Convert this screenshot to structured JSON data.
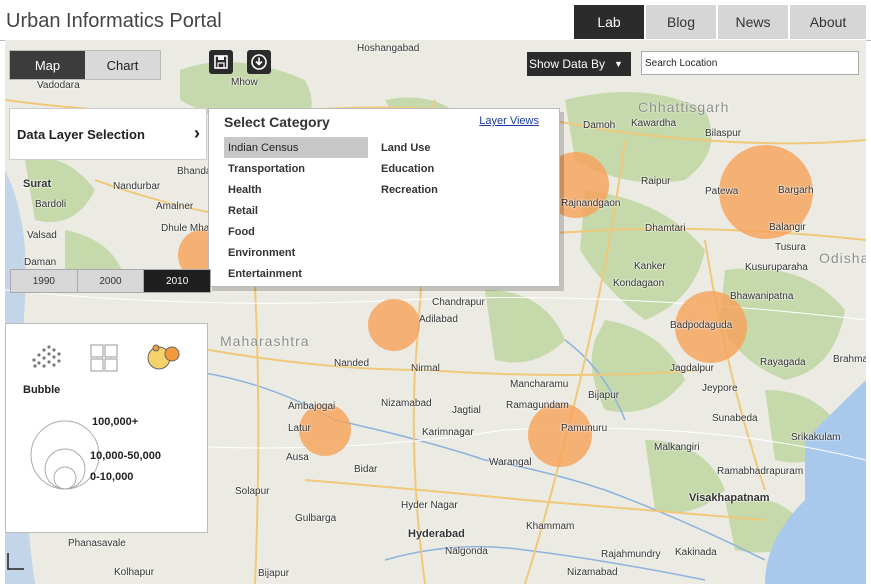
{
  "header": {
    "title": "Urban Informatics Portal",
    "nav": [
      "Lab",
      "Blog",
      "News",
      "About"
    ],
    "active_nav": "Lab"
  },
  "toolbar": {
    "view_modes": [
      "Map",
      "Chart"
    ],
    "active_view": "Map",
    "icons": [
      "save-icon",
      "download-icon"
    ],
    "show_data_label": "Show Data By",
    "search_placeholder": "Search Location"
  },
  "data_layer": {
    "label": "Data Layer Selection"
  },
  "category_panel": {
    "title": "Select Category",
    "link": "Layer Views",
    "col1": [
      "Indian Census",
      "Transportation",
      "Health",
      "Retail",
      "Food",
      "Environment",
      "Entertainment"
    ],
    "col2": [
      "Land Use",
      "Education",
      "Recreation"
    ],
    "selected": "Indian Census"
  },
  "years": {
    "items": [
      "1990",
      "2000",
      "2010"
    ],
    "active": "2010"
  },
  "legend": {
    "type_label": "Bubble",
    "icons": [
      "dots-icon",
      "grid-icon",
      "bubble-icon"
    ],
    "ranges": [
      "100,000+",
      "10,000-50,000",
      "0-10,000"
    ]
  },
  "map": {
    "bubble_color": "#f6a25c",
    "places": [
      {
        "name": "Vadodara"
      },
      {
        "name": "Hoshangabad"
      },
      {
        "name": "Mhow"
      },
      {
        "name": "Chhattisgarh",
        "big": true
      },
      {
        "name": "Damoh"
      },
      {
        "name": "Kawardha"
      },
      {
        "name": "Bilaspur"
      },
      {
        "name": "Surat"
      },
      {
        "name": "Nandurbar"
      },
      {
        "name": "Bardoli"
      },
      {
        "name": "Amalner"
      },
      {
        "name": "Valsad"
      },
      {
        "name": "Dhule Mhada"
      },
      {
        "name": "Daman"
      },
      {
        "name": "Bhandara"
      },
      {
        "name": "Rajnandgaon"
      },
      {
        "name": "Raipur"
      },
      {
        "name": "Dhamtari"
      },
      {
        "name": "Patewa"
      },
      {
        "name": "Bargarh"
      },
      {
        "name": "Kanker"
      },
      {
        "name": "Balangir"
      },
      {
        "name": "Tusura"
      },
      {
        "name": "Kusuruparaha"
      },
      {
        "name": "Odisha",
        "big": true
      },
      {
        "name": "Kondagaon"
      },
      {
        "name": "Bhawanipatna"
      },
      {
        "name": "Badpodaguda"
      },
      {
        "name": "Chandrapur"
      },
      {
        "name": "Adilabad"
      },
      {
        "name": "Maharashtra",
        "big": true
      },
      {
        "name": "Nanded"
      },
      {
        "name": "Nirmal"
      },
      {
        "name": "Jagdalpur"
      },
      {
        "name": "Rayagada"
      },
      {
        "name": "Brahmapur"
      },
      {
        "name": "Jeypore"
      },
      {
        "name": "Mancharamu"
      },
      {
        "name": "Ambajogai"
      },
      {
        "name": "Nizamabad"
      },
      {
        "name": "Jagtial"
      },
      {
        "name": "Ramagundam"
      },
      {
        "name": "Bijapur"
      },
      {
        "name": "Latur"
      },
      {
        "name": "Karimnagar"
      },
      {
        "name": "Pamunuru"
      },
      {
        "name": "Sunabeda"
      },
      {
        "name": "Srikakulam"
      },
      {
        "name": "Ausa"
      },
      {
        "name": "Warangal"
      },
      {
        "name": "Malkangiri"
      },
      {
        "name": "Bidar"
      },
      {
        "name": "Ramabhadrapuram"
      },
      {
        "name": "Solapur"
      },
      {
        "name": "Visakhapatnam",
        "bold": true
      },
      {
        "name": "Hyder Nagar"
      },
      {
        "name": "Gulbarga"
      },
      {
        "name": "Hyderabad",
        "bold": true
      },
      {
        "name": "Khammam"
      },
      {
        "name": "Phanasavale"
      },
      {
        "name": "Nalgonda"
      },
      {
        "name": "Rajahmundry"
      },
      {
        "name": "Kakinada"
      },
      {
        "name": "Kolhapur"
      },
      {
        "name": "Bijapur"
      },
      {
        "name": "Nizamabad"
      }
    ]
  }
}
